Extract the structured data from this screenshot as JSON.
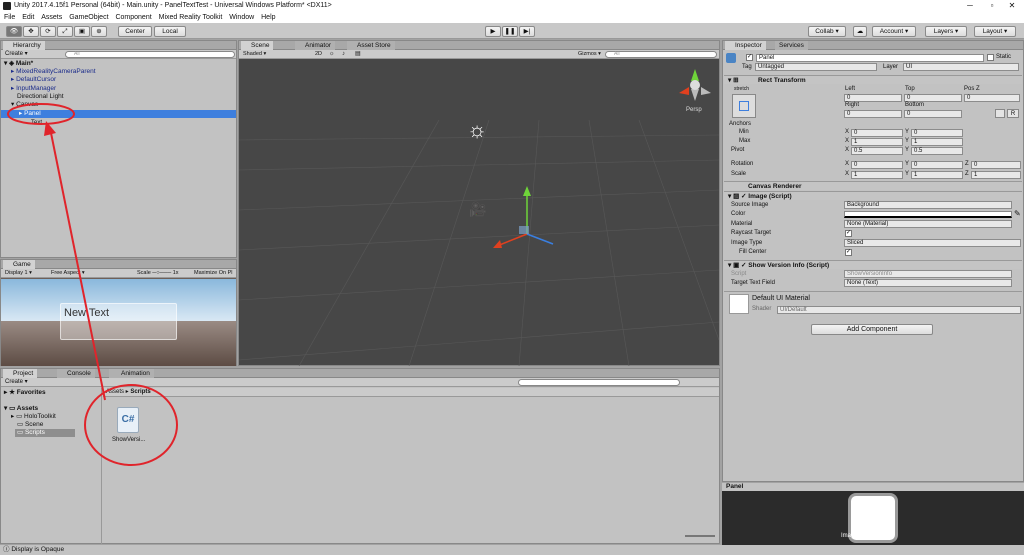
{
  "window": {
    "title": "Unity 2017.4.15f1 Personal (64bit) - Main.unity - PanelTextTest - Universal Windows Platform* <DX11>"
  },
  "menu": [
    "File",
    "Edit",
    "Assets",
    "GameObject",
    "Component",
    "Mixed Reality Toolkit",
    "Window",
    "Help"
  ],
  "toolbar": {
    "center": "Center",
    "local": "Local",
    "collab": "Collab",
    "account": "Account",
    "layers": "Layers",
    "layout": "Layout"
  },
  "hierarchy": {
    "tab": "Hierarchy",
    "create": "Create",
    "search": "All",
    "scene": "Main*",
    "items": [
      "MixedRealityCameraParent",
      "DefaultCursor",
      "InputManager",
      "Directional Light",
      "Canvas",
      "Panel",
      "Text"
    ]
  },
  "scene": {
    "tabs": [
      "Scene",
      "Animator",
      "Asset Store"
    ],
    "shading": "Shaded",
    "mode2d": "2D",
    "gizmos": "Gizmos",
    "search": "All",
    "persp": "Persp"
  },
  "game": {
    "tab": "Game",
    "display": "Display 1",
    "aspect": "Free Aspect",
    "scale_label": "Scale",
    "scale_value": "1x",
    "maximize": "Maximize On Pl",
    "text": "New Text"
  },
  "project": {
    "tabs": [
      "Project",
      "Console",
      "Animation"
    ],
    "create": "Create",
    "favorites": "Favorites",
    "assets": "Assets",
    "folders": [
      "HoloToolkit",
      "Scene",
      "Scripts"
    ],
    "breadcrumb": [
      "Assets",
      "Scripts"
    ],
    "file": "ShowVersi..."
  },
  "inspector": {
    "tabs": [
      "Inspector",
      "Services"
    ],
    "name": "Panel",
    "static": "Static",
    "tag_label": "Tag",
    "tag": "Untagged",
    "layer_label": "Layer",
    "layer": "UI",
    "rect": {
      "title": "Rect Transform",
      "stretch": "stretch",
      "left": "Left",
      "top": "Top",
      "posz": "Pos Z",
      "left_v": "0",
      "top_v": "0",
      "posz_v": "0",
      "right": "Right",
      "bottom": "Bottom",
      "right_v": "0",
      "bottom_v": "0",
      "anchors": "Anchors",
      "min": "Min",
      "max": "Max",
      "pivot": "Pivot",
      "min_x": "0",
      "min_y": "0",
      "max_x": "1",
      "max_y": "1",
      "pivot_x": "0.5",
      "pivot_y": "0.5",
      "rotation": "Rotation",
      "scale": "Scale",
      "rot_x": "0",
      "rot_y": "0",
      "rot_z": "0",
      "sc_x": "1",
      "sc_y": "1",
      "sc_z": "1",
      "xl": "X",
      "yl": "Y",
      "zl": "Z",
      "r": "R"
    },
    "canvas_renderer": "Canvas Renderer",
    "image": {
      "title": "Image (Script)",
      "source": "Source Image",
      "source_v": "Background",
      "color": "Color",
      "material": "Material",
      "material_v": "None (Material)",
      "raycast": "Raycast Target",
      "type": "Image Type",
      "type_v": "Sliced",
      "fill": "Fill Center"
    },
    "showversion": {
      "title": "Show Version Info (Script)",
      "script": "Script",
      "script_v": "ShowVersionInfo",
      "target": "Target Text Field",
      "target_v": "None (Text)"
    },
    "material": {
      "name": "Default UI Material",
      "shader_label": "Shader",
      "shader": "UI/Default"
    },
    "add_component": "Add Component"
  },
  "preview": {
    "title": "Panel",
    "label": "Panel",
    "size": "Image Size: 32x32"
  },
  "status": "Display is Opaque",
  "colors": {
    "selection": "#3e7fde",
    "annotation": "#e0242b",
    "scene_bg": "#474747"
  }
}
